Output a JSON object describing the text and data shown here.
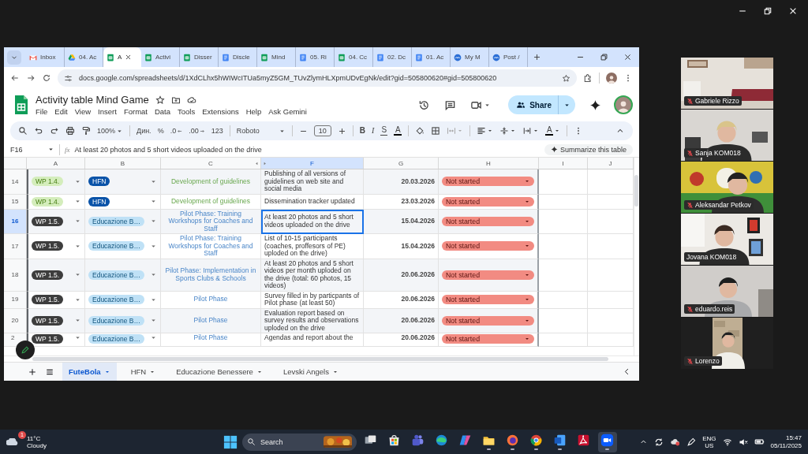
{
  "browser": {
    "tabs": [
      {
        "kind": "mail",
        "label": "Inbox",
        "selected": false
      },
      {
        "kind": "drive",
        "label": "04. Ac",
        "selected": false
      },
      {
        "kind": "sheets",
        "label": "A",
        "selected": true
      },
      {
        "kind": "sheets",
        "label": "Activi",
        "selected": false
      },
      {
        "kind": "sheets",
        "label": "Disser",
        "selected": false
      },
      {
        "kind": "docs",
        "label": "Discle",
        "selected": false
      },
      {
        "kind": "sheets",
        "label": "Mind",
        "selected": false
      },
      {
        "kind": "docs",
        "label": "05. Ri",
        "selected": false
      },
      {
        "kind": "sheets",
        "label": "04. Cc",
        "selected": false
      },
      {
        "kind": "docs",
        "label": "02. Dc",
        "selected": false
      },
      {
        "kind": "docs",
        "label": "01. Ac",
        "selected": false
      },
      {
        "kind": "meet",
        "label": "My M",
        "selected": false
      },
      {
        "kind": "meet",
        "label": "Post /",
        "selected": false
      }
    ],
    "url": "docs.google.com/spreadsheets/d/1XdCLhx5hWIWcITUa5myZ5GM_TUvZlymHLXpmUDvEgNk/edit?gid=505800620#gid=505800620"
  },
  "sheet": {
    "title": "Activity table Mind Game",
    "menus": [
      "File",
      "Edit",
      "View",
      "Insert",
      "Format",
      "Data",
      "Tools",
      "Extensions",
      "Help",
      "Ask Gemini"
    ],
    "toolbar": {
      "zoom": "100%",
      "number_formats": [
        {
          "kind": "currency",
          "label": "Дин."
        },
        {
          "kind": "percent",
          "label": "%"
        },
        {
          "kind": "decrease",
          "label": ".0"
        },
        {
          "kind": "increase",
          "label": ".00"
        },
        {
          "kind": "more",
          "label": "123"
        }
      ],
      "font": "Roboto",
      "font_size": "10",
      "text_styles": [
        {
          "kind": "bold",
          "label": "B"
        },
        {
          "kind": "italic",
          "label": "I"
        },
        {
          "kind": "strike",
          "label": "S"
        },
        {
          "kind": "color",
          "label": "A"
        }
      ],
      "rotate_label": "A"
    },
    "share_label": "Share",
    "cell_ref": "F16",
    "fx": "fx",
    "formula": "At least 20 photos and 5 short videos uploaded on the drive",
    "summarize": "Summarize this table",
    "columns": [
      {
        "label": "A",
        "selected": false
      },
      {
        "label": "B",
        "selected": false
      },
      {
        "label": "C",
        "selected": false
      },
      {
        "label": "F",
        "selected": true
      },
      {
        "label": "G",
        "selected": false
      },
      {
        "label": "H",
        "selected": false
      },
      {
        "label": "I",
        "selected": false
      },
      {
        "label": "J",
        "selected": false
      }
    ],
    "rows": [
      {
        "number": "14",
        "selected": false,
        "wp": {
          "label": "WP 1.4.",
          "color": "#d4edbc"
        },
        "partner": {
          "label": "HFN",
          "color": "#0a53a8"
        },
        "activity": {
          "text": "Development of guidelines",
          "kind": "guidelines"
        },
        "output": "Publishing of all versions of guidelines on web site and social media",
        "date": "20.03.2026",
        "status": "Not started"
      },
      {
        "number": "15",
        "selected": false,
        "wp": {
          "label": "WP 1.4.",
          "color": "#d4edbc"
        },
        "partner": {
          "label": "HFN",
          "color": "#0a53a8"
        },
        "activity": {
          "text": "Development of guidelines",
          "kind": "guidelines"
        },
        "output": "Dissemination tracker updated",
        "date": "23.03.2026",
        "status": "Not started"
      },
      {
        "number": "16",
        "selected": true,
        "wp": {
          "label": "WP 1.5.",
          "color": "#3d3d3d"
        },
        "partner": {
          "label": "Educazione B…",
          "color": "#bfe1f6"
        },
        "activity": {
          "text": "Pilot Phase: Training Workshops for Coaches and Staff",
          "kind": "pilot"
        },
        "output": "At least 20 photos and 5 short videos uploaded on the drive",
        "date": "15.04.2026",
        "status": "Not started"
      },
      {
        "number": "17",
        "selected": false,
        "wp": {
          "label": "WP 1.5.",
          "color": "#3d3d3d"
        },
        "partner": {
          "label": "Educazione B…",
          "color": "#bfe1f6"
        },
        "activity": {
          "text": "Pilot Phase: Training Workshops for Coaches and Staff",
          "kind": "pilot"
        },
        "output": "List of 10-15 participants (coaches, proffesors of PE) uploded on the drive)",
        "date": "15.04.2026",
        "status": "Not started"
      },
      {
        "number": "18",
        "selected": false,
        "wp": {
          "label": "WP 1.5.",
          "color": "#3d3d3d"
        },
        "partner": {
          "label": "Educazione B…",
          "color": "#bfe1f6"
        },
        "activity": {
          "text": "Pilot Phase: Implementation in Sports Clubs & Schools",
          "kind": "pilot"
        },
        "output": "At least 20 photos and 5 short videos per month uploded on the drive (total: 60 photos, 15 videos)",
        "date": "20.06.2026",
        "status": "Not started"
      },
      {
        "number": "19",
        "selected": false,
        "wp": {
          "label": "WP 1.5.",
          "color": "#3d3d3d"
        },
        "partner": {
          "label": "Educazione B…",
          "color": "#bfe1f6"
        },
        "activity": {
          "text": "Pilot Phase",
          "kind": "pilot"
        },
        "output": "Survey filled in by particpants of Pilot phase (at least 50)",
        "date": "20.06.2026",
        "status": "Not started"
      },
      {
        "number": "20",
        "selected": false,
        "wp": {
          "label": "WP 1.5.",
          "color": "#3d3d3d"
        },
        "partner": {
          "label": "Educazione B…",
          "color": "#bfe1f6"
        },
        "activity": {
          "text": "Pilot Phase",
          "kind": "pilot"
        },
        "output": "Evaluation report based on survey results and observations uploded on the drive",
        "date": "20.06.2026",
        "status": "Not started"
      },
      {
        "number": "2",
        "selected": false,
        "wp": {
          "label": "WP 1.5.",
          "color": "#3d3d3d"
        },
        "partner": {
          "label": "Educazione B…",
          "color": "#bfe1f6"
        },
        "activity": {
          "text": "Pilot Phase",
          "kind": "pilot"
        },
        "output": "Agendas and report about the",
        "date": "20.06.2026",
        "status": "Not started"
      }
    ],
    "sheet_tabs": [
      {
        "label": "FuteBola",
        "selected": true
      },
      {
        "label": "HFN",
        "selected": false
      },
      {
        "label": "Educazione Benessere",
        "selected": false
      },
      {
        "label": "Levski Angels",
        "selected": false
      }
    ]
  },
  "participants": [
    {
      "name": "Gabriele Rizzo",
      "muted": true,
      "speaking": false
    },
    {
      "name": "Sanja KOM018",
      "muted": true,
      "speaking": false
    },
    {
      "name": "Aleksandar Petkov",
      "muted": true,
      "speaking": false
    },
    {
      "name": "Jovana KOM018",
      "muted": false,
      "speaking": true
    },
    {
      "name": "eduardo.reis",
      "muted": true,
      "speaking": false
    },
    {
      "name": "Lorenzo",
      "muted": true,
      "speaking": false
    }
  ],
  "taskbar": {
    "weather": {
      "badge": "1",
      "temperature": "11°C",
      "condition": "Cloudy"
    },
    "search": "Search",
    "apps": [
      {
        "kind": "taskview",
        "open": false,
        "active": false
      },
      {
        "kind": "store",
        "open": false,
        "active": false
      },
      {
        "kind": "teams",
        "open": false,
        "active": false
      },
      {
        "kind": "edge",
        "open": false,
        "active": false
      },
      {
        "kind": "copilot",
        "open": false,
        "active": false
      },
      {
        "kind": "files",
        "open": true,
        "active": false
      },
      {
        "kind": "firefox",
        "open": true,
        "active": false
      },
      {
        "kind": "chrome",
        "open": true,
        "active": false
      },
      {
        "kind": "word",
        "open": true,
        "active": false
      },
      {
        "kind": "pdf",
        "open": false,
        "active": false
      },
      {
        "kind": "zoom",
        "open": true,
        "active": true
      }
    ],
    "language": "ENG",
    "region": "US",
    "time": "15:47",
    "date": "05/11/2025"
  }
}
